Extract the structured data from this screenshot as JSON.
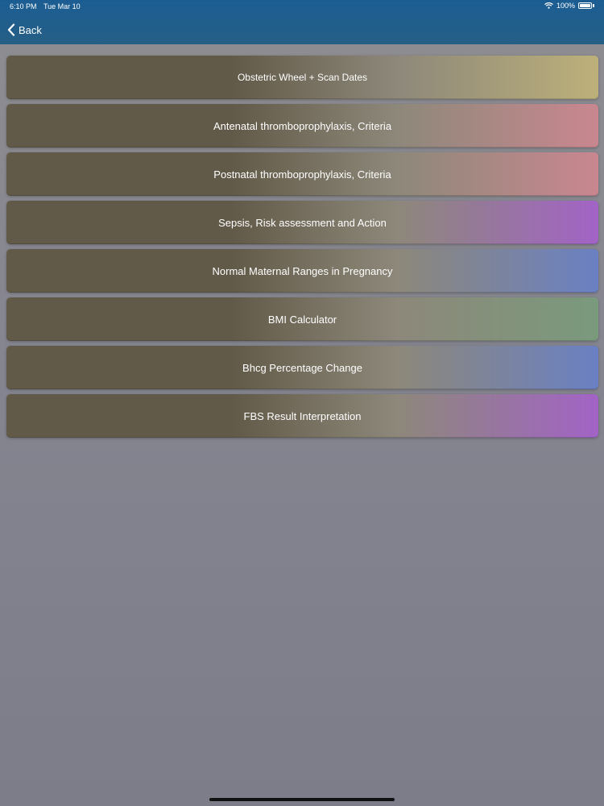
{
  "status_bar": {
    "time": "6:10 PM",
    "date": "Tue Mar 10",
    "battery": "100%",
    "battery_level": 1.0
  },
  "header": {
    "back_label": "Back",
    "back_icon": "chevron-left-icon"
  },
  "menu": {
    "items": [
      {
        "label": "Obstetric Wheel + Scan Dates",
        "accent": "#bdb07a"
      },
      {
        "label": "Antenatal thromboprophylaxis, Criteria",
        "accent": "#c9878f"
      },
      {
        "label": "Postnatal thromboprophylaxis, Criteria",
        "accent": "#c9878f"
      },
      {
        "label": "Sepsis, Risk assessment and Action",
        "accent": "#a263c6"
      },
      {
        "label": "Normal Maternal Ranges in Pregnancy",
        "accent": "#6a80c3"
      },
      {
        "label": "BMI Calculator",
        "accent": "#7a9a7c"
      },
      {
        "label": "Bhcg Percentage Change",
        "accent": "#6a80c3"
      },
      {
        "label": "FBS Result Interpretation",
        "accent": "#a263c6"
      }
    ]
  },
  "colors": {
    "header": "#1f5e8e",
    "background": "#858590",
    "button_base": "#625a48"
  }
}
